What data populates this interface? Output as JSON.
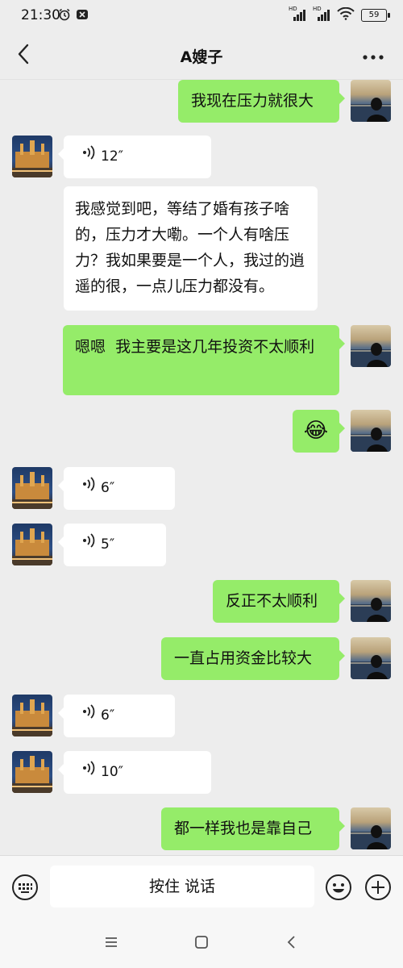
{
  "status_bar": {
    "time": "21:30",
    "hd_1": "HD",
    "hd_2": "HD",
    "battery": "59"
  },
  "header": {
    "title": "A嫂子"
  },
  "messages": [
    {
      "side": "self",
      "type": "text",
      "text": "我现在压力就很大"
    },
    {
      "side": "other",
      "type": "voice",
      "duration": "12″"
    },
    {
      "side": "other",
      "type": "text",
      "text": "我感觉到吧，等结了婚有孩子啥的，压力才大嘞。一个人有啥压力？我如果要是一个人，我过的逍遥的很，一点儿压力都没有。"
    },
    {
      "side": "self",
      "type": "text",
      "text": "嗯嗯  我主要是这几年投资不太顺利"
    },
    {
      "side": "self",
      "type": "emoji",
      "text": "😂"
    },
    {
      "side": "other",
      "type": "voice",
      "duration": "6″"
    },
    {
      "side": "other",
      "type": "voice",
      "duration": "5″"
    },
    {
      "side": "self",
      "type": "text",
      "text": "反正不太顺利"
    },
    {
      "side": "self",
      "type": "text",
      "text": "一直占用资金比较大"
    },
    {
      "side": "other",
      "type": "voice",
      "duration": "6″"
    },
    {
      "side": "other",
      "type": "voice",
      "duration": "10″"
    },
    {
      "side": "self",
      "type": "text",
      "text": "都一样我也是靠自己"
    }
  ],
  "input_bar": {
    "hold_to_talk": "按住 说话"
  },
  "colors": {
    "background": "#ededed",
    "self_bubble": "#95ec69",
    "other_bubble": "#ffffff"
  },
  "icons": [
    "back-icon",
    "more-icon",
    "voice-wave-icon",
    "keyboard-icon",
    "emoji-icon",
    "plus-icon",
    "menu-icon",
    "home-icon",
    "nav-back-icon"
  ]
}
